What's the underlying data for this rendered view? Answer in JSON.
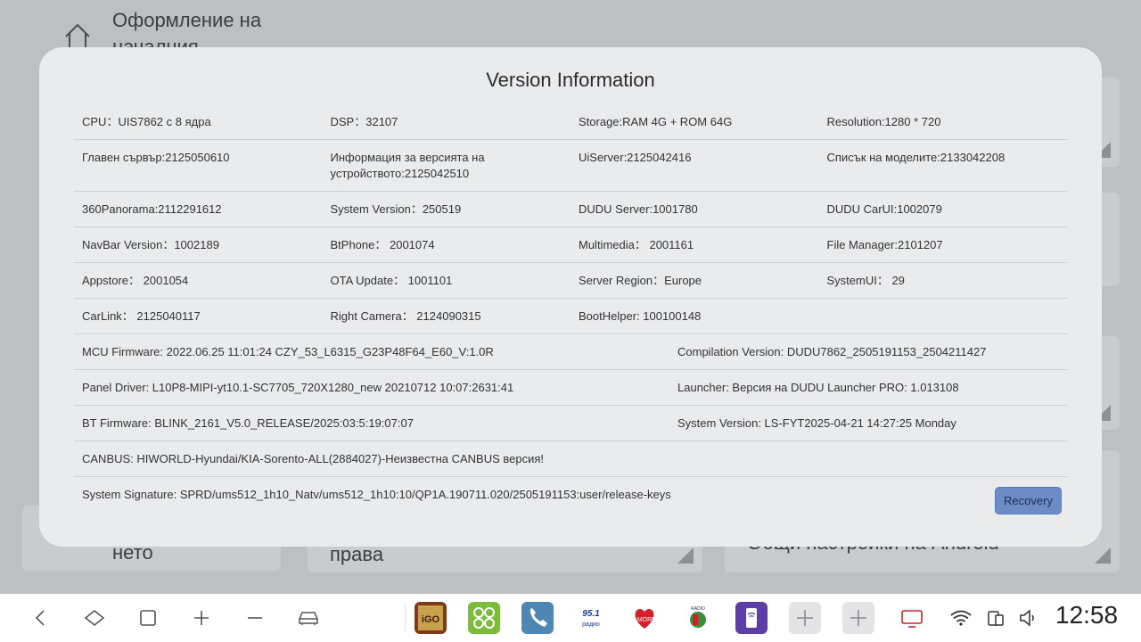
{
  "background": {
    "page_title": "Оформление на началния",
    "card_bottom_left_text": "нето",
    "card_bottom_middle_text": "права",
    "card_bottom_right_text": "Общи настройки на Android"
  },
  "modal": {
    "title": "Version Information",
    "rows_4col": [
      [
        "CPU：UIS7862 с 8 ядра",
        "DSP：32107",
        "Storage:RAM 4G + ROM 64G",
        "Resolution:1280 * 720"
      ],
      [
        "Главен сървър:2125050610",
        "Информация за версията на устройството:2125042510",
        "UiServer:2125042416",
        "Списък на моделите:2133042208"
      ],
      [
        "360Panorama:2112291612",
        "System Version：250519",
        "DUDU Server:1001780",
        "DUDU CarUI:1002079"
      ],
      [
        "NavBar Version：1002189",
        "BtPhone： 2001074",
        "Multimedia： 2001161",
        "File Manager:2101207"
      ],
      [
        "Appstore： 2001054",
        "OTA Update： 1001101",
        "Server Region：Europe",
        "SystemUI： 29"
      ],
      [
        "CarLink： 2125040117",
        "Right Camera： 2124090315",
        "BootHelper: 100100148",
        ""
      ]
    ],
    "rows_2col": [
      [
        "MCU Firmware:  2022.06.25 11:01:24 CZY_53_L6315_G23P48F64_E60_V:1.0R",
        "Compilation Version:  DUDU7862_2505191153_2504211427"
      ],
      [
        "Panel Driver:  L10P8-MIPI-yt10.1-SC7705_720X1280_new 20210712 10:07:2631:41",
        "Launcher:  Версия на DUDU Launcher PRO: 1.013108"
      ],
      [
        "BT Firmware:  BLINK_2161_V5.0_RELEASE/2025:03:5:19:07:07",
        "System Version:  LS-FYT2025-04-21 14:27:25 Monday"
      ]
    ],
    "rows_1col": [
      "CANBUS:  HIWORLD-Hyundai/KIA-Sorento-ALL(2884027)-Неизвестна CANBUS версия!",
      "System Signature:  SPRD/ums512_1h10_Natv/ums512_1h10:10/QP1A.190711.020/2505191153:user/release-keys"
    ],
    "recovery_label": "Recovery"
  },
  "taskbar": {
    "clock": "12:58",
    "nav_icons": [
      "back-icon",
      "home-diamond-icon",
      "recents-icon",
      "volume-up-icon",
      "volume-down-icon",
      "car-icon"
    ],
    "apps": [
      {
        "name": "igo-app-icon",
        "label": "iGO",
        "color": "#8a3a1c"
      },
      {
        "name": "app-grid-icon",
        "color": "#7dbb3c"
      },
      {
        "name": "phone-app-icon",
        "color": "#4f86b3"
      },
      {
        "name": "radio-951-icon",
        "label": "95.1 Кааро радио",
        "color": "#ffffff"
      },
      {
        "name": "radio-amore-icon",
        "label": "Amore",
        "color": "#ffffff"
      },
      {
        "name": "radio-app-icon",
        "color": "#ffffff"
      },
      {
        "name": "wireless-app-icon",
        "color": "#5b3ea6"
      },
      {
        "name": "add-app-icon",
        "color": "#e4e4e6"
      },
      {
        "name": "add-app-icon-2",
        "color": "#e4e4e6"
      },
      {
        "name": "screen-app-icon",
        "color": "#ffffff"
      }
    ],
    "status_icons": [
      "wifi-icon",
      "sim-battery-icon",
      "speaker-icon"
    ]
  }
}
